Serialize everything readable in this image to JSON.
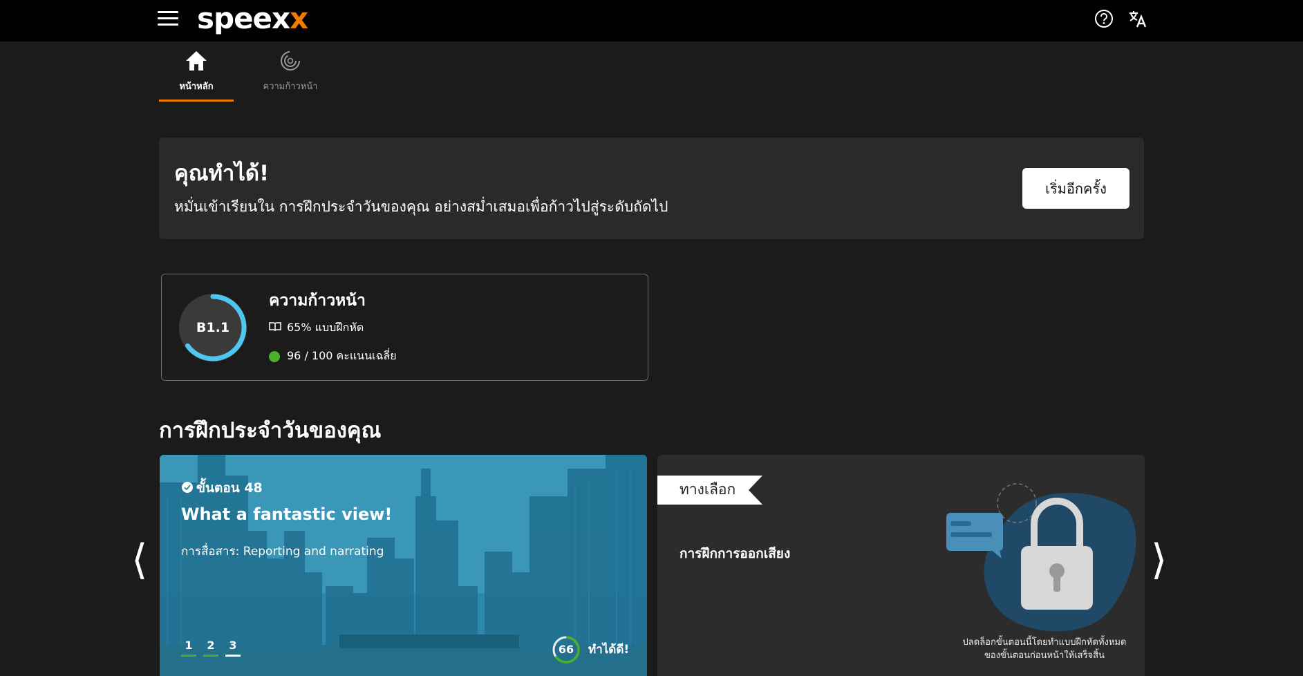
{
  "header": {
    "logo_main": "speex",
    "logo_accent": "x",
    "menu_icon": "hamburger-menu-icon",
    "help_icon": "help-circle-icon",
    "language_icon": "translate-icon"
  },
  "tabs": [
    {
      "label": "หน้าหลัก",
      "icon": "home-icon",
      "active": true
    },
    {
      "label": "ความก้าวหน้า",
      "icon": "progress-ring-icon",
      "active": false
    }
  ],
  "banner": {
    "title": "คุณทำได้!",
    "subtitle": "หมั่นเข้าเรียนใน การฝึกประจำวันของคุณ อย่างสม่ำเสมอเพื่อก้าวไปสู่ระดับถัดไป",
    "restart_label": "เริ่มอีกครั้ง"
  },
  "progress": {
    "title": "ความก้าวหน้า",
    "level": "B1.1",
    "level_progress": 0.65,
    "exercises_text": "65% แบบฝึกหัด",
    "score_text": "96 / 100 คะแนนเฉลี่ย"
  },
  "daily": {
    "title": "การฝึกประจำวันของคุณ",
    "lesson": {
      "step": "ขั้นตอน 48",
      "title": "What a fantastic view!",
      "topic": "การสื่อสาร: Reporting and narrating",
      "pages": [
        "1",
        "2",
        "3"
      ],
      "score": "66",
      "score_fraction": 0.66,
      "score_label": "ทำได้ดี!"
    },
    "option": {
      "ribbon": "ทางเลือก",
      "title": "การฝึกการออกเสียง",
      "unlock_line1": "ปลดล็อกขั้นตอนนี้โดยทำแบบฝึกหัดทั้งหมด",
      "unlock_line2": "ของขั้นตอนก่อนหน้าให้เสร็จสิ้น"
    },
    "prev_arrow": "⟨",
    "next_arrow": "⟩"
  },
  "colors": {
    "accent": "#f07c00",
    "ring": "#4fc6f0",
    "good": "#4caf2a",
    "lesson_overlay": "#2a8fb0"
  }
}
